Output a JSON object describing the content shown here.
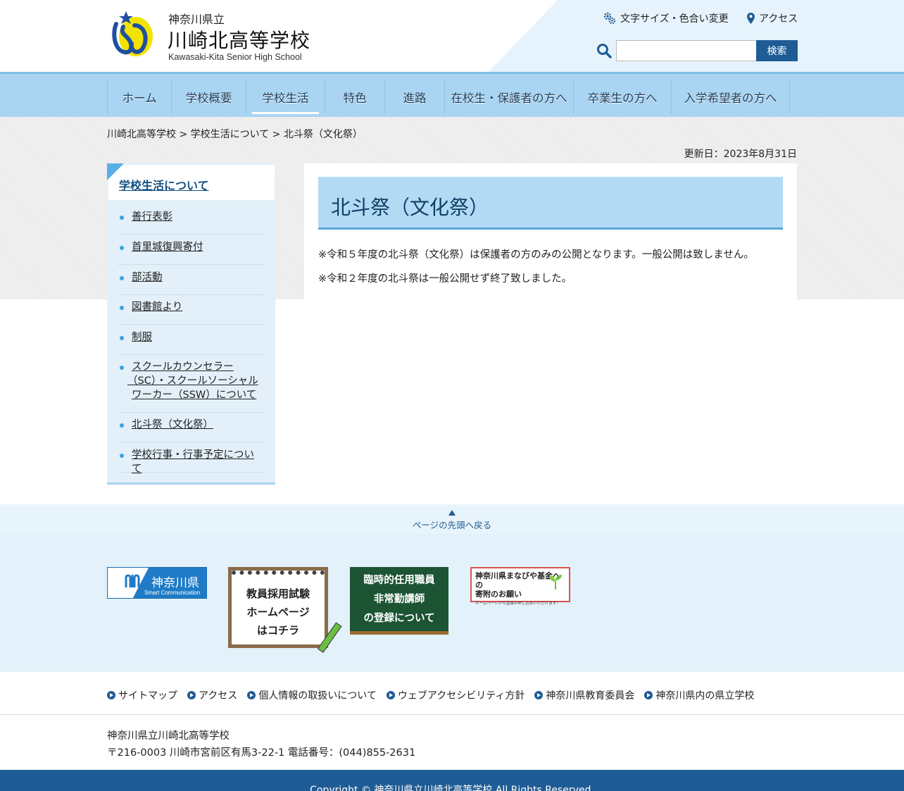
{
  "header": {
    "pref_name": "神奈川県立",
    "school_name": "川崎北高等学校",
    "school_en": "Kawasaki-Kita Senior High School",
    "font_color_link": "文字サイズ・色合い変更",
    "access_link": "アクセス",
    "search": {
      "placeholder": "",
      "value": "",
      "button": "検索"
    }
  },
  "nav": {
    "items": [
      {
        "label": "ホーム"
      },
      {
        "label": "学校概要"
      },
      {
        "label": "学校生活"
      },
      {
        "label": "特色"
      },
      {
        "label": "進路"
      },
      {
        "label": "在校生・保護者の方へ"
      },
      {
        "label": "卒業生の方へ"
      },
      {
        "label": "入学希望者の方へ"
      }
    ]
  },
  "breadcrumb": "川崎北高等学校 > 学校生活について > 北斗祭（文化祭）",
  "updated": "更新日：2023年8月31日",
  "sidebar": {
    "title": "学校生活について",
    "items": [
      {
        "label": "善行表彰"
      },
      {
        "label": "首里城復興寄付"
      },
      {
        "label": "部活動"
      },
      {
        "label": "図書館より"
      },
      {
        "label": "制服"
      },
      {
        "label_line1": "スクールカウンセラー",
        "label_line2": "（SC）・スクールソーシャル",
        "label_line3": "ワーカー（SSW）について"
      },
      {
        "label": "北斗祭（文化祭）"
      },
      {
        "label": "学校行事・行事予定について"
      }
    ]
  },
  "main": {
    "title": "北斗祭（文化祭）",
    "paragraphs": [
      "※令和５年度の北斗祭（文化祭）は保護者の方のみの公開となります。一般公開は致しません。",
      "※令和２年度の北斗祭は一般公開せず終了致しました。"
    ]
  },
  "back_to_top": "ページの先頭へ戻る",
  "banners": {
    "kanagawa": {
      "name": "神奈川県",
      "sub": "Smart Communication"
    },
    "teacher_exam": {
      "line1": "教員採用試験",
      "line2": "ホームページ",
      "line3": "はコチラ"
    },
    "temporary": {
      "line1": "臨時的任用職員",
      "line2": "非常勤講師",
      "line3": "の登録について"
    },
    "fund": {
      "line1": "神奈川県まなびや基金への",
      "line2": "寄附のお願い",
      "line3": "ホームページから直接お申し込みいただけます！"
    }
  },
  "footer": {
    "links": [
      {
        "label": "サイトマップ"
      },
      {
        "label": "アクセス"
      },
      {
        "label": "個人情報の取扱いについて"
      },
      {
        "label": "ウェブアクセシビリティ方針"
      },
      {
        "label": "神奈川県教育委員会"
      },
      {
        "label": "神奈川県内の県立学校"
      }
    ],
    "school": "神奈川県立川崎北高等学校",
    "address": "〒216-0003 川崎市宮前区有馬3-22-1 電話番号：(044)855-2631",
    "copyright": "Copyright © 神奈川県立川崎北高等学校 All Rights Reserved."
  },
  "colors": {
    "accent": "#1f5c95",
    "nav_bg": "#a9d4f2",
    "title_bg": "#b2daf5",
    "sidebar_bg": "#e3f0f9"
  }
}
